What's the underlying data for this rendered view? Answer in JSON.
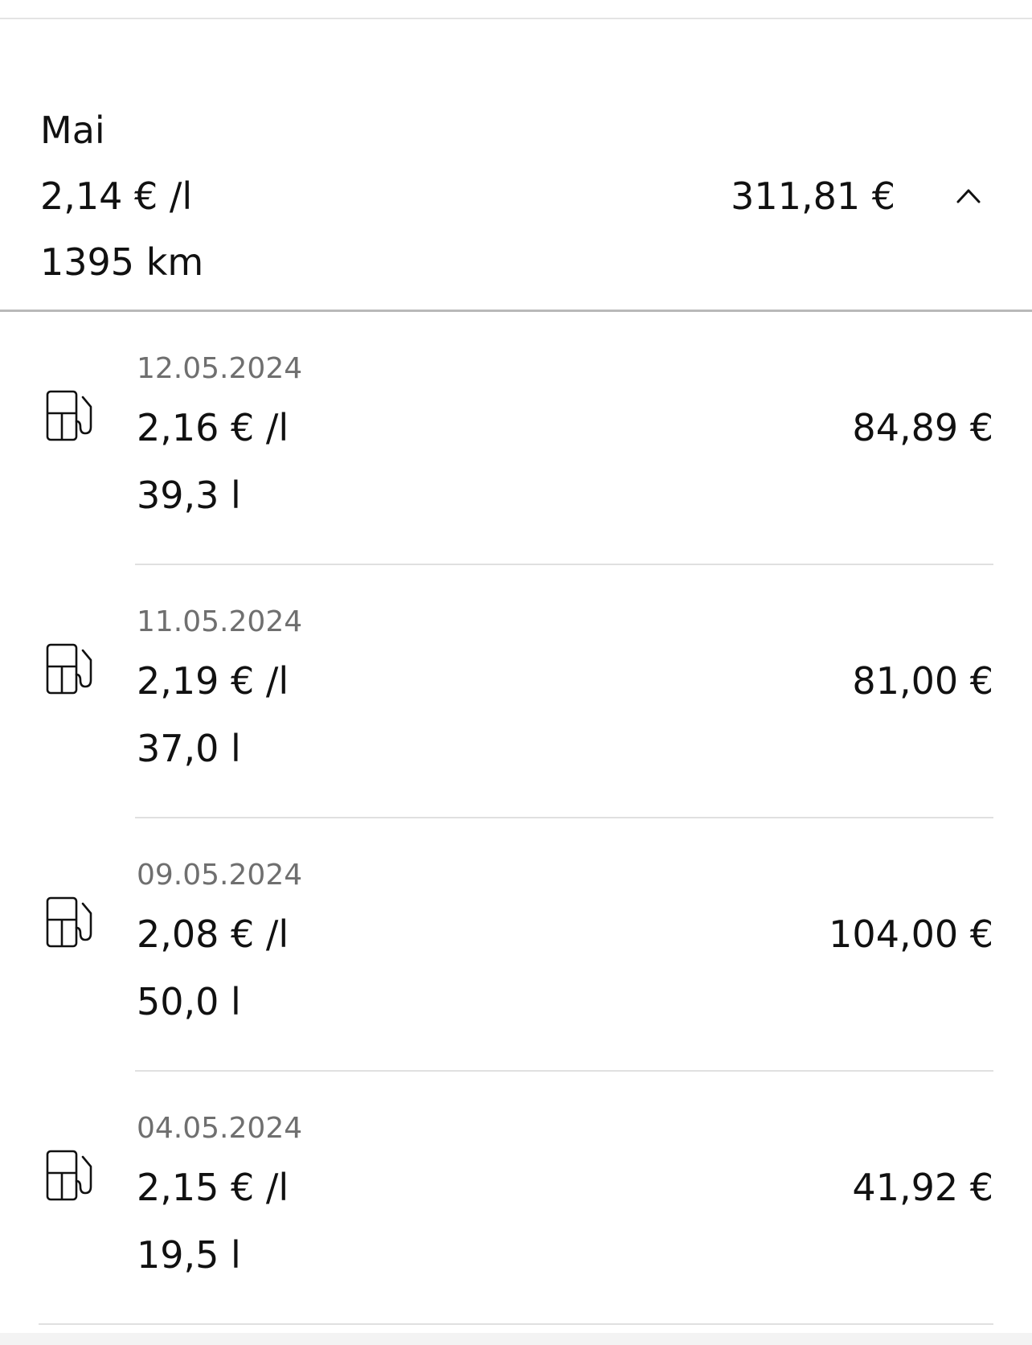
{
  "month": {
    "name": "Mai",
    "avg_price": "2,14 € /l",
    "distance": "1395 km",
    "total": "311,81 €",
    "expanded": true
  },
  "entries": [
    {
      "date": "12.05.2024",
      "price_per_liter": "2,16 € /l",
      "volume": "39,3 l",
      "amount": "84,89 €",
      "icon": "fuel-pump-icon"
    },
    {
      "date": "11.05.2024",
      "price_per_liter": "2,19 € /l",
      "volume": "37,0 l",
      "amount": "81,00 €",
      "icon": "fuel-pump-icon"
    },
    {
      "date": "09.05.2024",
      "price_per_liter": "2,08 € /l",
      "volume": "50,0 l",
      "amount": "104,00 €",
      "icon": "fuel-pump-icon"
    },
    {
      "date": "04.05.2024",
      "price_per_liter": "2,15 € /l",
      "volume": "19,5 l",
      "amount": "41,92 €",
      "icon": "fuel-pump-icon"
    }
  ]
}
